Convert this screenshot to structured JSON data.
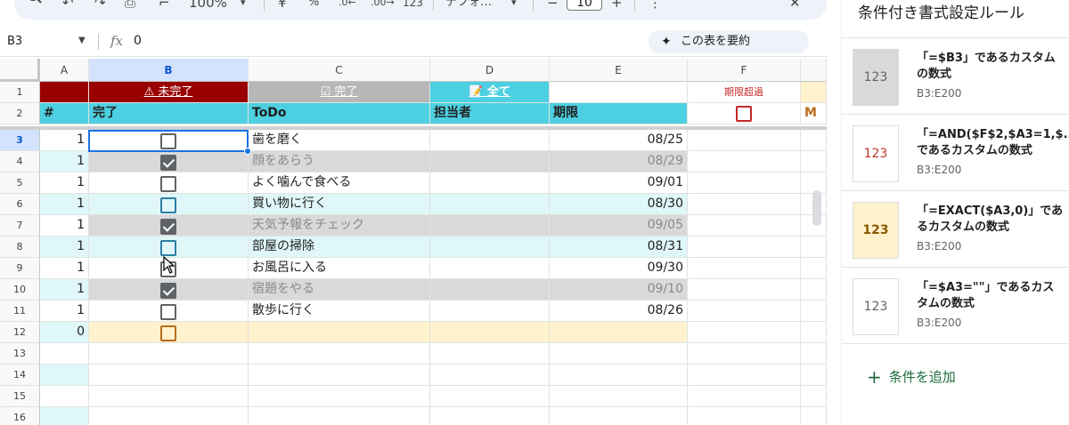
{
  "toolbar": {
    "zoom": "100%",
    "currency": "¥",
    "percent": "%",
    "dec_decrease": ".0←",
    "dec_increase": ".00→",
    "number_format": "123",
    "font_name": "デフォ…",
    "minus": "−",
    "font_size": "10",
    "plus": "+",
    "more": "⋮",
    "close": "✕"
  },
  "formula_bar": {
    "cell_ref": "B3",
    "fx_label": "fx",
    "value": "0",
    "summarize_label": "この表を要約"
  },
  "grid": {
    "columns": [
      "A",
      "B",
      "C",
      "D",
      "E",
      "F"
    ],
    "row1": {
      "b": "⚠ 未完了",
      "c": "☑ 完了",
      "d": "📝 全て",
      "f": "期限超過"
    },
    "headers": {
      "a": "#",
      "b": "完了",
      "c": "ToDo",
      "d": "担当者",
      "e": "期限",
      "g": "M"
    },
    "rows": [
      {
        "num": "3",
        "a": "1",
        "checked": false,
        "todo": "歯を磨く",
        "due": "08/25"
      },
      {
        "num": "4",
        "a": "1",
        "checked": true,
        "todo": "顔をあらう",
        "due": "08/29"
      },
      {
        "num": "5",
        "a": "1",
        "checked": false,
        "todo": "よく噛んで食べる",
        "due": "09/01"
      },
      {
        "num": "6",
        "a": "1",
        "checked": false,
        "todo": "買い物に行く",
        "due": "08/30"
      },
      {
        "num": "7",
        "a": "1",
        "checked": true,
        "todo": "天気予報をチェック",
        "due": "09/05"
      },
      {
        "num": "8",
        "a": "1",
        "checked": false,
        "todo": "部屋の掃除",
        "due": "08/31"
      },
      {
        "num": "9",
        "a": "1",
        "checked": false,
        "todo": "お風呂に入る",
        "due": "09/30"
      },
      {
        "num": "10",
        "a": "1",
        "checked": true,
        "todo": "宿題をやる",
        "due": "09/10"
      },
      {
        "num": "11",
        "a": "1",
        "checked": false,
        "todo": "散歩に行く",
        "due": "08/26"
      },
      {
        "num": "12",
        "a": "0",
        "checked": false,
        "todo": "",
        "due": ""
      }
    ],
    "empty_rows": [
      "13",
      "14",
      "15",
      "16"
    ],
    "row_labels_top": [
      "1",
      "2"
    ]
  },
  "panel": {
    "title": "条件付き書式設定ルール",
    "rules": [
      {
        "preview": "123",
        "text": "「=$B3」であるカスタムの数式",
        "range": "B3:E200",
        "preview_bg": "#d9d9d9",
        "preview_color": "#5f6368"
      },
      {
        "preview": "123",
        "text": "「=AND($F$2,$A3=1,$... であるカスタムの数式",
        "range": "B3:E200",
        "preview_bg": "#ffffff",
        "preview_color": "#c0392b"
      },
      {
        "preview": "123",
        "text": "「=EXACT($A3,0)」であるカスタムの数式",
        "range": "B3:E200",
        "preview_bg": "#fff2cc",
        "preview_color": "#8a5a00"
      },
      {
        "preview": "123",
        "text": "「=$A3=\"\"」であるカスタムの数式",
        "range": "B3:E200",
        "preview_bg": "#ffffff",
        "preview_color": "#5f6368"
      }
    ],
    "add_rule": "条件を追加"
  },
  "colors": {
    "header_cyan": "#4dd0e1",
    "incomplete_red": "#990000",
    "complete_gray": "#b7b7b7",
    "done_row_gray": "#d9d9d9",
    "alt_row_cyan": "#e0f7fa",
    "new_row_yellow": "#fff2cc",
    "selection_blue": "#1a73e8"
  }
}
